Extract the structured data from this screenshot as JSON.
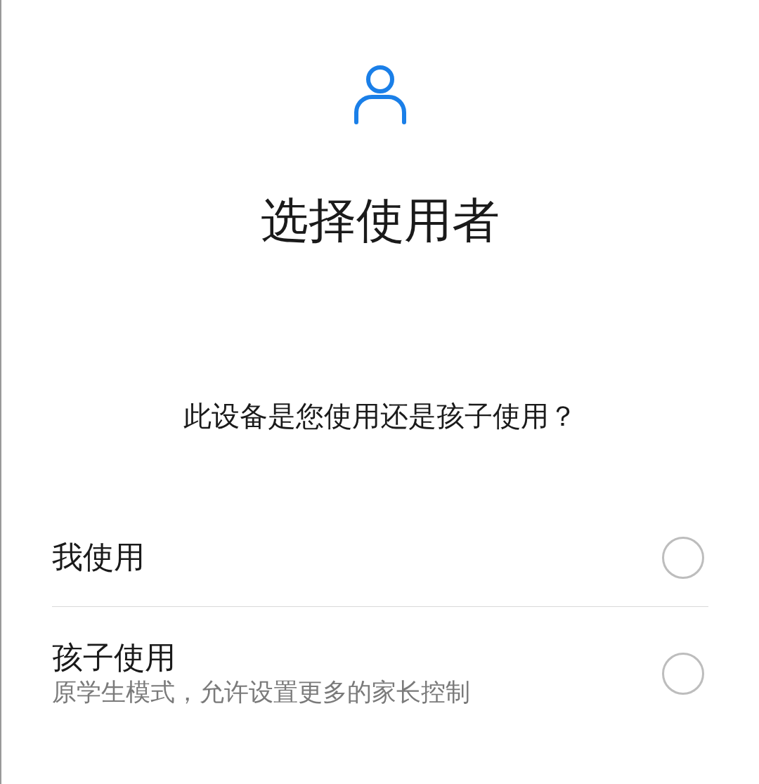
{
  "title": "选择使用者",
  "question": "此设备是您使用还是孩子使用？",
  "options": [
    {
      "label": "我使用",
      "selected": false
    },
    {
      "label": "孩子使用",
      "description": "原学生模式，允许设置更多的家长控制",
      "selected": false
    }
  ]
}
